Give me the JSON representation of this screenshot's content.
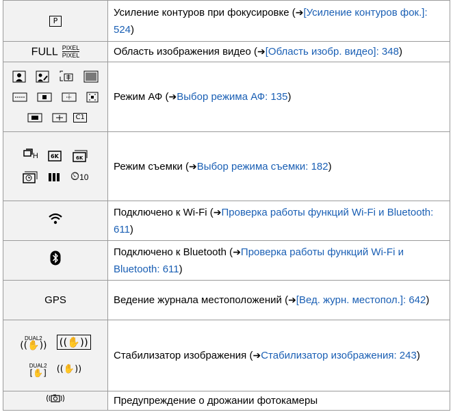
{
  "rows": [
    {
      "icon": "P",
      "pre": "Усиление контуров при фокусировке (",
      "link": "[Усиление контуров фок.]: 524",
      "post": ")"
    },
    {
      "icon_full": "FULL",
      "icon_pix_top": "PIXEL",
      "icon_pix_bottom": "PIXEL",
      "pre": "Область изображения видео (",
      "link": "[Область изобр. видео]: 348",
      "post": ")"
    },
    {
      "af_icons": [
        "face-eye-icon",
        "face-body-icon",
        "tracking-icon",
        "225-area-icon",
        "zone-h-icon",
        "zone-v-icon",
        "zone-square-icon",
        "custom-multi-icon",
        "1-area-plus-icon",
        "1-area-icon",
        "pinpoint-icon",
        "c1-icon"
      ],
      "af_c1": "C1",
      "pre": "Режим АФ (",
      "link": "Выбор режима АФ: 135",
      "post": ")"
    },
    {
      "drive_icons": [
        "burst-h-icon",
        "6k-photo-icon",
        "6k-burst-icon",
        "interval-icon",
        "bracket-icon",
        "self-timer-icon"
      ],
      "timer_label": "10",
      "burst_label": "H",
      "pre": "Режим съемки (",
      "link": "Выбор режима съемки: 182",
      "post": ")"
    },
    {
      "icon": "wifi-icon",
      "pre": "Подключено к Wi-Fi (",
      "link": "Проверка работы функций Wi-Fi и Bluetooth: 611",
      "post": ")"
    },
    {
      "icon": "bluetooth-icon",
      "pre": "Подключено к Bluetooth (",
      "link": "Проверка работы функций Wi-Fi и Bluetooth: 611",
      "post": ")"
    },
    {
      "icon_text": "GPS",
      "pre": "Ведение журнала местоположений (",
      "link": "[Вед. журн. местопол.]: 642",
      "post": ")"
    },
    {
      "stab_icons": [
        "dual2-stabilizer-icon",
        "body-stabilizer-icon",
        "dual2-video-stabilizer-icon",
        "stabilizer-off-icon"
      ],
      "dual_label": "DUAL2",
      "pre": "Стабилизатор изображения (",
      "link": "Стабилизатор изображения: 243",
      "post": ")"
    },
    {
      "icon": "camera-shake-icon",
      "text": "Предупреждение о дрожании фотокамеры"
    }
  ],
  "arrow": "➔"
}
